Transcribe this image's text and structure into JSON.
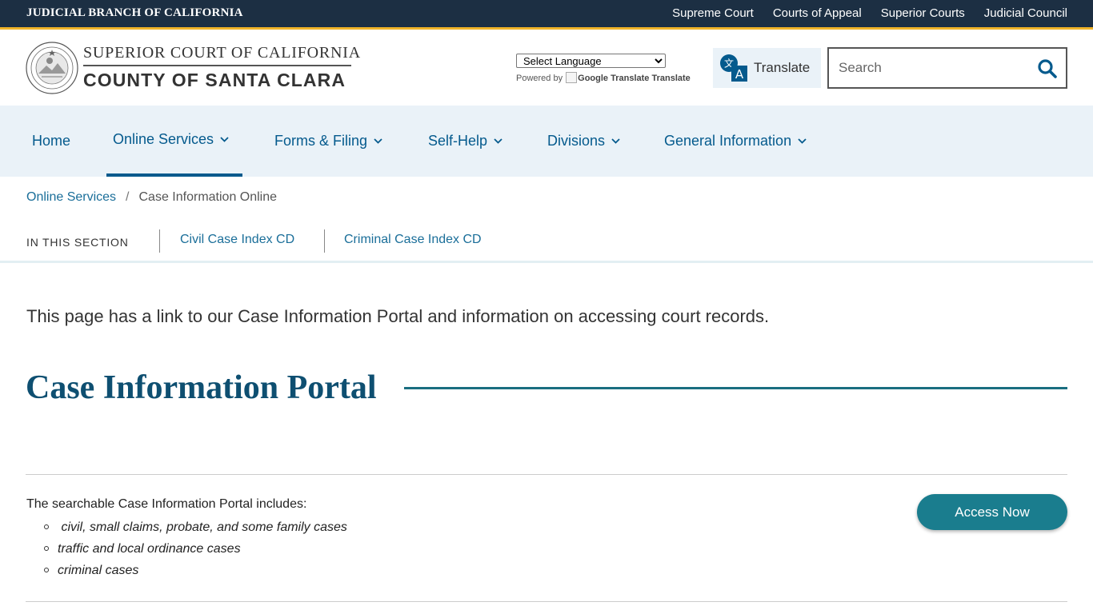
{
  "topbar": {
    "brand": "JUDICIAL BRANCH OF CALIFORNIA",
    "links": [
      "Supreme Court",
      "Courts of Appeal",
      "Superior Courts",
      "Judicial Council"
    ]
  },
  "header": {
    "logo_line1": "SUPERIOR COURT OF CALIFORNIA",
    "logo_line2": "COUNTY OF SANTA CLARA",
    "language_select": "Select Language",
    "powered_by": "Powered by",
    "google_translate_alt": "Google Translate",
    "google_translate_link": "Translate",
    "translate_button": "Translate",
    "search_placeholder": "Search"
  },
  "nav": {
    "items": [
      {
        "label": "Home"
      },
      {
        "label": "Online Services"
      },
      {
        "label": "Forms & Filing"
      },
      {
        "label": "Self-Help"
      },
      {
        "label": "Divisions"
      },
      {
        "label": "General Information"
      }
    ]
  },
  "breadcrumb": {
    "parent": "Online Services",
    "separator": "/",
    "current": "Case Information Online"
  },
  "section_nav": {
    "label": "IN THIS SECTION",
    "links": [
      "Civil Case Index CD",
      "Criminal Case Index CD"
    ]
  },
  "content": {
    "intro": "This page has a link to our Case Information Portal and information on accessing court records.",
    "heading": "Case Information Portal",
    "portal_text": "The searchable Case Information Portal includes:",
    "portal_items": [
      " civil, small claims, probate, and some family cases",
      "traffic and local ordinance cases",
      "criminal cases"
    ],
    "access_button": "Access Now"
  },
  "colors": {
    "topbar_bg": "#1c2f43",
    "topbar_accent": "#f0b429",
    "nav_bg": "#eaf2f8",
    "nav_text": "#045a8d",
    "heading": "#0e4f71",
    "button": "#1a7d8e"
  }
}
